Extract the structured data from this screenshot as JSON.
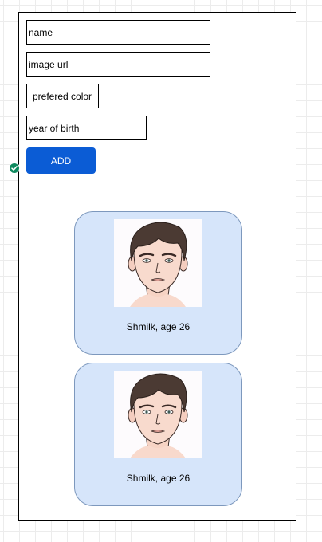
{
  "form": {
    "name_placeholder": "name",
    "image_url_placeholder": "image url",
    "color_placeholder": "prefered color",
    "year_placeholder": "year of birth",
    "add_label": "ADD"
  },
  "cards": [
    {
      "caption": "Shmilk, age 26",
      "image": "male-face-illustration"
    },
    {
      "caption": "Shmilk, age 26",
      "image": "male-face-illustration"
    }
  ],
  "colors": {
    "button": "#0b5cd5",
    "card_background": "#d6e5fa",
    "card_border": "#7d98bd",
    "status_badge": "#0f8a5f"
  }
}
